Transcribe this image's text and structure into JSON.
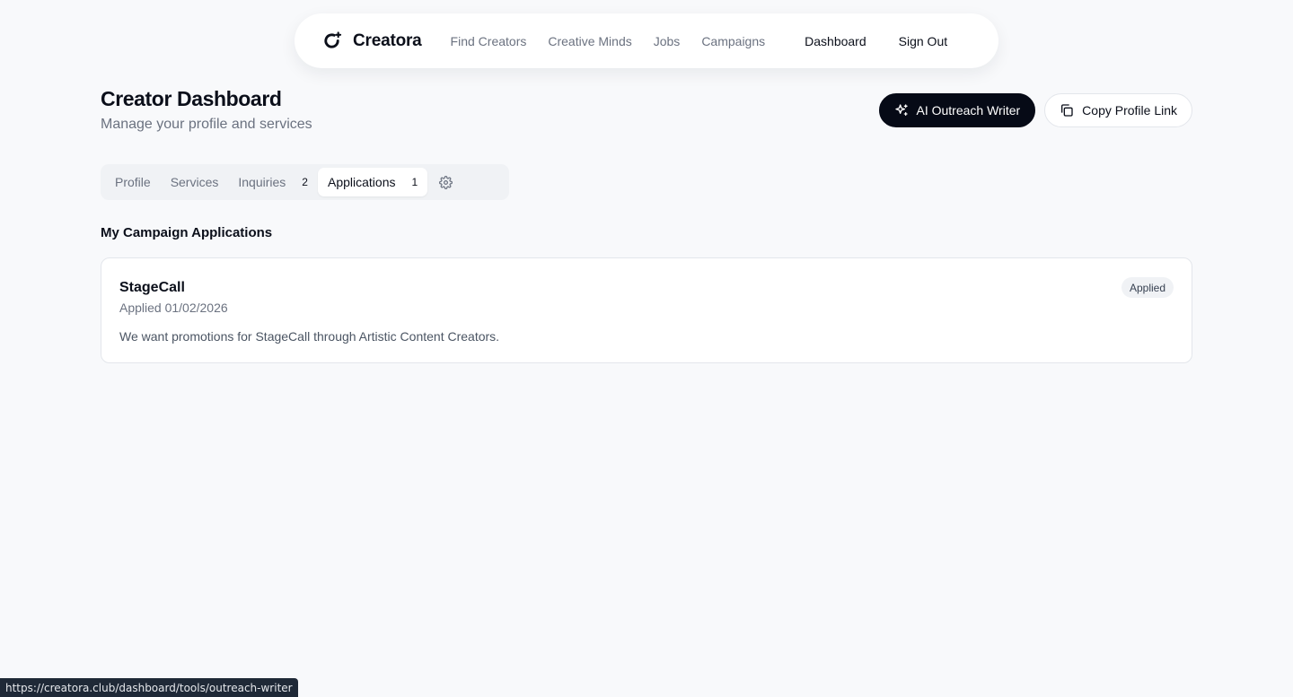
{
  "nav": {
    "brand": "Creatora",
    "links": [
      {
        "label": "Find Creators"
      },
      {
        "label": "Creative Minds"
      },
      {
        "label": "Jobs"
      },
      {
        "label": "Campaigns"
      }
    ],
    "dashboard": "Dashboard",
    "sign_out": "Sign Out"
  },
  "header": {
    "title": "Creator Dashboard",
    "subtitle": "Manage your profile and services",
    "outreach_button": "AI Outreach Writer",
    "copy_link_button": "Copy Profile Link"
  },
  "tabs": [
    {
      "label": "Profile",
      "count": ""
    },
    {
      "label": "Services",
      "count": ""
    },
    {
      "label": "Inquiries",
      "count": "2"
    },
    {
      "label": "Applications",
      "count": "1"
    }
  ],
  "section": {
    "title": "My Campaign Applications"
  },
  "applications": [
    {
      "name": "StageCall",
      "applied": "Applied 01/02/2026",
      "description": "We want promotions for StageCall through Artistic Content Creators.",
      "status": "Applied"
    }
  ],
  "statusbar": {
    "url": "https://creatora.club/dashboard/tools/outreach-writer"
  },
  "colors": {
    "accent_dark": "#060a16",
    "muted_text": "#6b7280",
    "background": "#f8f9fb"
  },
  "icons": [
    "creatora-logo-icon",
    "sparkles-icon",
    "copy-icon",
    "settings-gear-icon"
  ]
}
